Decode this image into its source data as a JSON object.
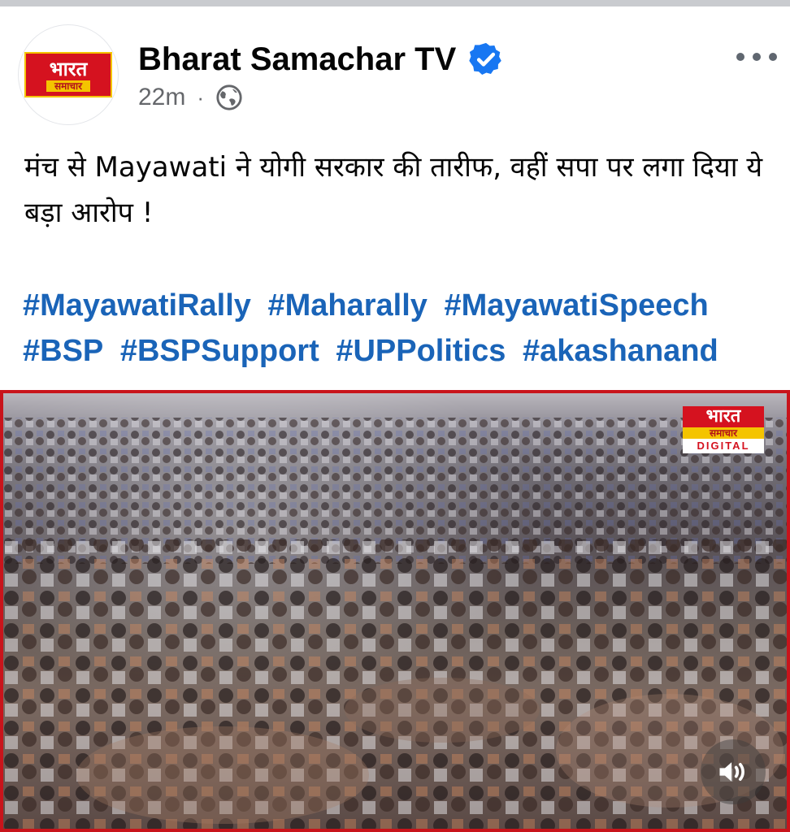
{
  "post": {
    "page_name": "Bharat Samachar TV",
    "time": "22m",
    "separator": "·",
    "avatar_logo": {
      "line1": "भारत",
      "line2": "समाचार"
    },
    "text": "मंच से Mayawati ने योगी सरकार की तारीफ, वहीं सपा पर लगा दिया ये बड़ा आरोप !",
    "hashtags": [
      "#MayawatiRally",
      "#Maharally",
      "#MayawatiSpeech",
      "#BSP",
      "#BSPSupport",
      "#UPPolitics",
      "#akashanand"
    ]
  },
  "video": {
    "badge": {
      "line1": "भारत",
      "line2": "समाचार",
      "line3": "DIGITAL"
    },
    "sound_icon": "speaker-icon"
  },
  "colors": {
    "hashtag": "#1a64b8",
    "verified": "#1877f2",
    "brand_red": "#d5121f",
    "brand_yellow": "#f4c400",
    "video_border": "#c8141b"
  },
  "icons": [
    "verified-badge-icon",
    "globe-icon",
    "more-options-icon",
    "speaker-icon"
  ]
}
